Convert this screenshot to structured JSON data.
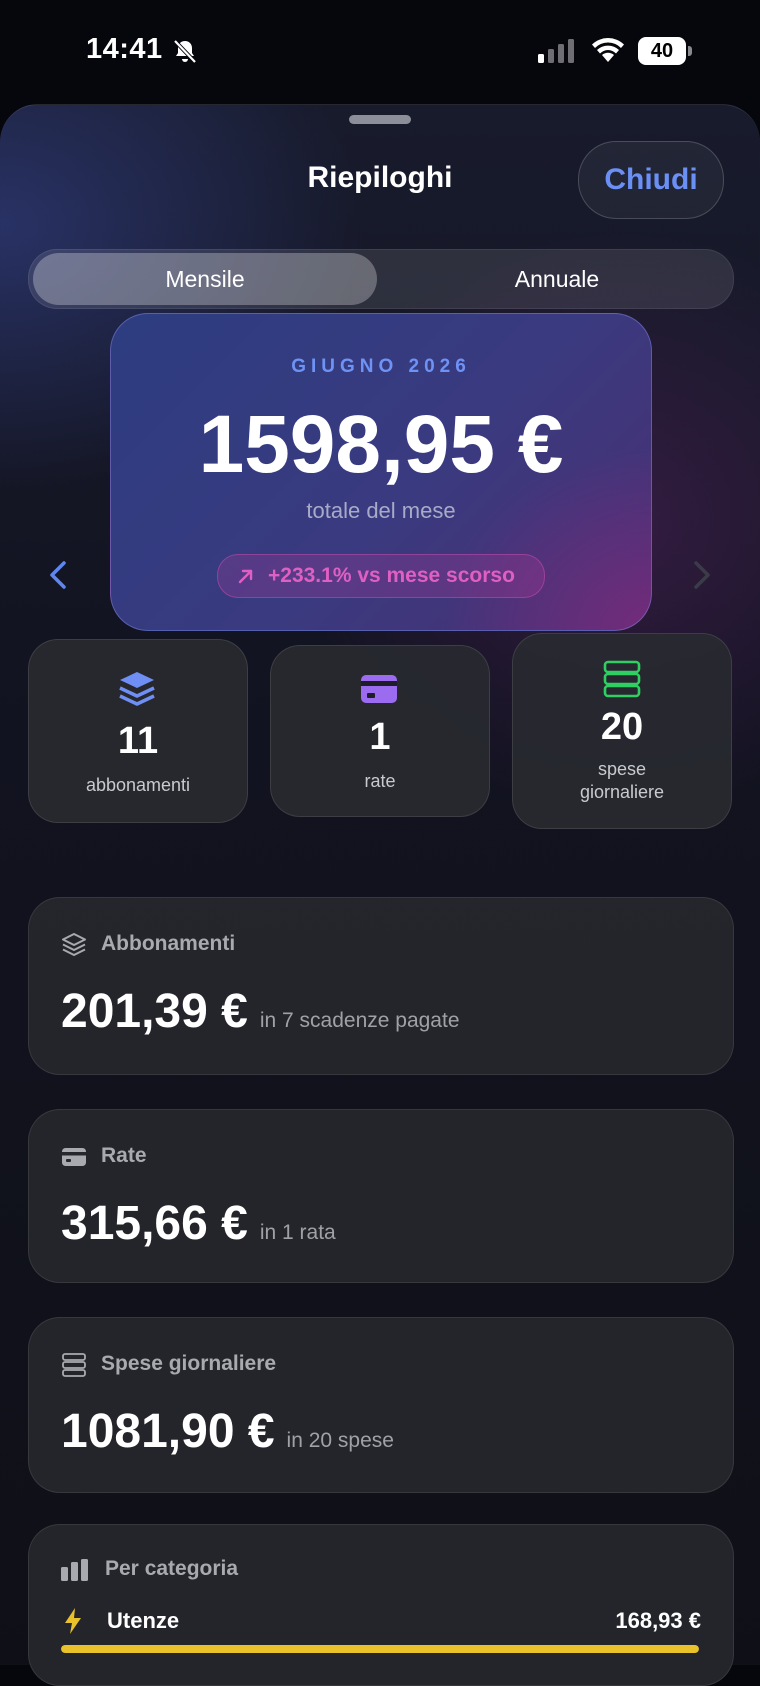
{
  "status_bar": {
    "time": "14:41",
    "battery": "40"
  },
  "sheet": {
    "title": "Riepiloghi",
    "close_label": "Chiudi"
  },
  "segmented": {
    "monthly": "Mensile",
    "yearly": "Annuale",
    "selected": "Mensile"
  },
  "hero": {
    "month": "GIUGNO 2026",
    "total": "1598,95 €",
    "caption": "totale del mese",
    "change": "+233.1% vs mese scorso"
  },
  "stats": [
    {
      "value": "11",
      "label": "abbonamenti",
      "icon": "layers-icon",
      "color": "#6f8ff5"
    },
    {
      "value": "1",
      "label": "rate",
      "icon": "credit-card-icon",
      "color": "#9b6cf0"
    },
    {
      "value": "20",
      "label": "spese giornaliere",
      "icon": "list-icon",
      "color": "#2fcf62"
    }
  ],
  "sections": [
    {
      "title": "Abbonamenti",
      "amount": "201,39 €",
      "detail": "in 7 scadenze pagate",
      "icon": "layers-icon"
    },
    {
      "title": "Rate",
      "amount": "315,66 €",
      "detail": "in 1 rata",
      "icon": "credit-card-icon"
    },
    {
      "title": "Spese giornaliere",
      "amount": "1081,90 €",
      "detail": "in 20 spese",
      "icon": "list-icon"
    }
  ],
  "categories": {
    "title": "Per categoria",
    "items": [
      {
        "name": "Utenze",
        "amount": "168,93 €",
        "share": 1.0,
        "color": "#e9c22b",
        "icon": "bolt-icon"
      }
    ]
  }
}
